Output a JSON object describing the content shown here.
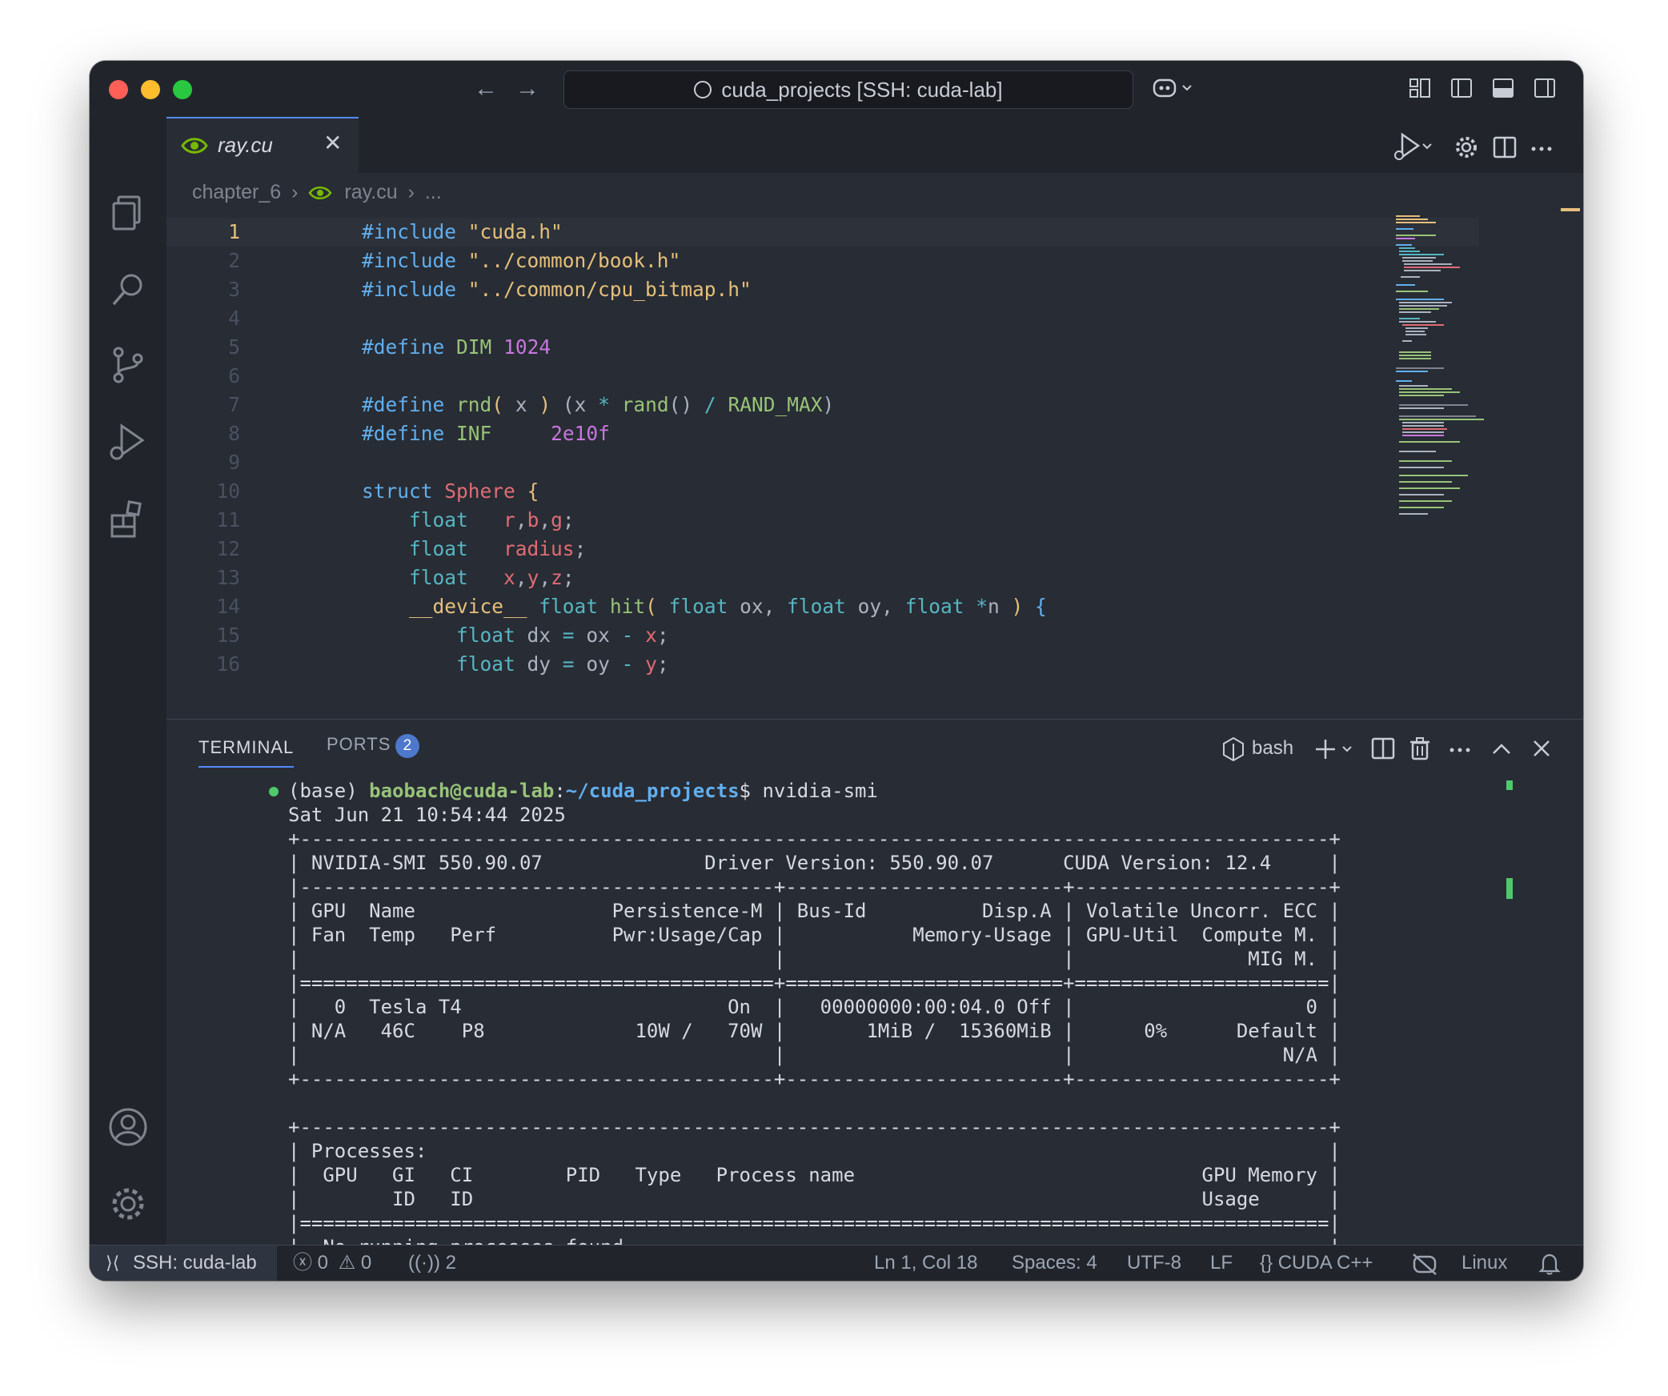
{
  "titlebar": {
    "search_text": "cuda_projects [SSH: cuda-lab]"
  },
  "tab": {
    "filename": "ray.cu",
    "close": "✕"
  },
  "breadcrumb": {
    "folder": "chapter_6",
    "file": "ray.cu",
    "more": "..."
  },
  "editor": {
    "line_numbers": [
      "1",
      "2",
      "3",
      "4",
      "5",
      "6",
      "7",
      "8",
      "9",
      "10",
      "11",
      "12",
      "13",
      "14",
      "15",
      "16"
    ],
    "current_line": "1"
  },
  "panel": {
    "tab_terminal": "TERMINAL",
    "tab_ports": "PORTS",
    "ports_count": "2",
    "shell": "bash"
  },
  "terminal": {
    "prompt_env": "(base) ",
    "prompt_user": "baobach@cuda-lab",
    "prompt_sep": ":",
    "prompt_path": "~/cuda_projects",
    "prompt_end": "$ ",
    "command": "nvidia-smi",
    "lines": [
      "Sat Jun 21 10:54:44 2025",
      "+-----------------------------------------------------------------------------------------+",
      "| NVIDIA-SMI 550.90.07              Driver Version: 550.90.07      CUDA Version: 12.4     |",
      "|-----------------------------------------+------------------------+----------------------+",
      "| GPU  Name                 Persistence-M | Bus-Id          Disp.A | Volatile Uncorr. ECC |",
      "| Fan  Temp   Perf          Pwr:Usage/Cap |           Memory-Usage | GPU-Util  Compute M. |",
      "|                                         |                        |               MIG M. |",
      "|=========================================+========================+======================|",
      "|   0  Tesla T4                       On  |   00000000:00:04.0 Off |                    0 |",
      "| N/A   46C    P8             10W /   70W |       1MiB /  15360MiB |      0%      Default |",
      "|                                         |                        |                  N/A |",
      "+-----------------------------------------+------------------------+----------------------+",
      "",
      "+-----------------------------------------------------------------------------------------+",
      "| Processes:                                                                              |",
      "|  GPU   GI   CI        PID   Type   Process name                              GPU Memory |",
      "|        ID   ID                                                               Usage      |",
      "|=========================================================================================|",
      "|  No running processes found                                                             |",
      "+-----------------------------------------------------------------------------------------+"
    ]
  },
  "statusbar": {
    "remote": "SSH: cuda-lab",
    "errors": "0",
    "warnings": "0",
    "ports": "2",
    "position": "Ln 1, Col 18",
    "spaces": "Spaces: 4",
    "encoding": "UTF-8",
    "eol": "LF",
    "language": "CUDA C++",
    "os": "Linux"
  },
  "colors": {
    "accent": "#528bff",
    "string": "#e5c07b",
    "keyword": "#56b6c2",
    "terminal_user": "#98c379",
    "terminal_path": "#61afef"
  }
}
